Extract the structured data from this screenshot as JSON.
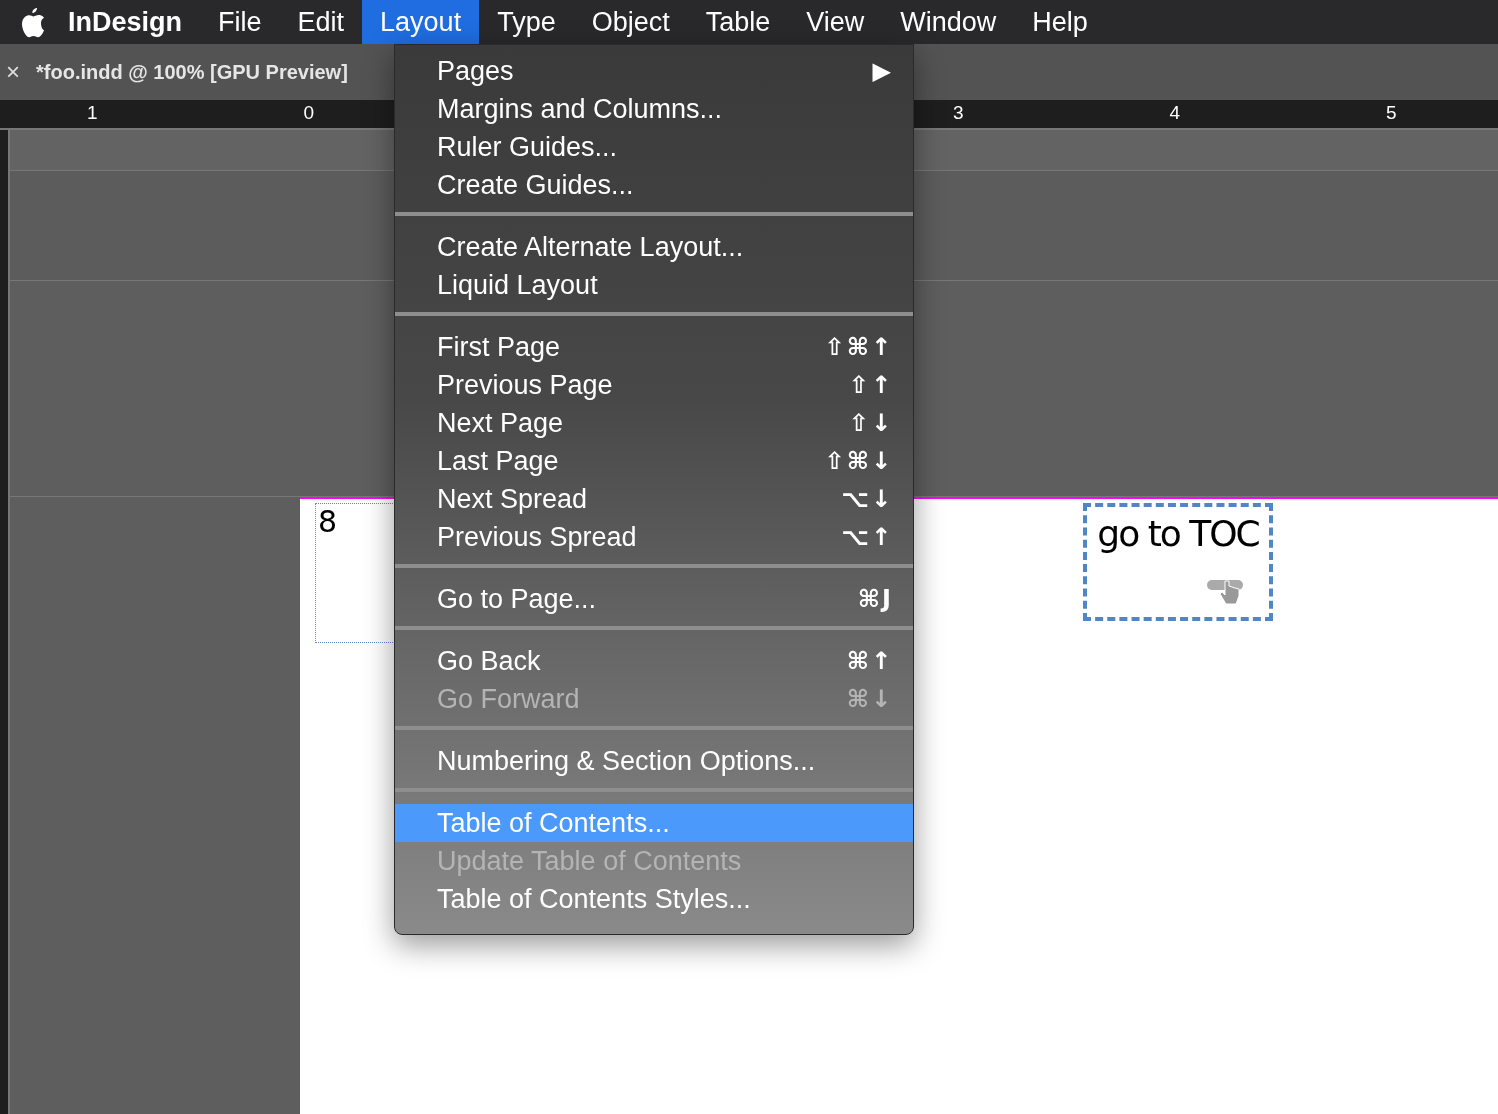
{
  "menubar": {
    "app_name": "InDesign",
    "items": [
      {
        "label": "File",
        "selected": false
      },
      {
        "label": "Edit",
        "selected": false
      },
      {
        "label": "Layout",
        "selected": true
      },
      {
        "label": "Type",
        "selected": false
      },
      {
        "label": "Object",
        "selected": false
      },
      {
        "label": "Table",
        "selected": false
      },
      {
        "label": "View",
        "selected": false
      },
      {
        "label": "Window",
        "selected": false
      },
      {
        "label": "Help",
        "selected": false
      }
    ]
  },
  "document_tab": {
    "close": "×",
    "title": "*foo.indd @ 100% [GPU Preview]"
  },
  "ruler": {
    "labels": [
      "1",
      "0",
      "3",
      "4",
      "5"
    ]
  },
  "menu": {
    "groups": [
      [
        {
          "label": "Pages",
          "shortcut": "▶",
          "disabled": false,
          "selected": false
        },
        {
          "label": "Margins and Columns...",
          "disabled": false,
          "selected": false
        },
        {
          "label": "Ruler Guides...",
          "disabled": false,
          "selected": false
        },
        {
          "label": "Create Guides...",
          "disabled": false,
          "selected": false
        }
      ],
      [
        {
          "label": "Create Alternate Layout...",
          "disabled": false,
          "selected": false
        },
        {
          "label": "Liquid Layout",
          "disabled": false,
          "selected": false
        }
      ],
      [
        {
          "label": "First Page",
          "shortcut": "⇧⌘↑",
          "disabled": false,
          "selected": false
        },
        {
          "label": "Previous Page",
          "shortcut": "⇧↑",
          "disabled": false,
          "selected": false
        },
        {
          "label": "Next Page",
          "shortcut": "⇧↓",
          "disabled": false,
          "selected": false
        },
        {
          "label": "Last Page",
          "shortcut": "⇧⌘↓",
          "disabled": false,
          "selected": false
        },
        {
          "label": "Next Spread",
          "shortcut": "⌥↓",
          "disabled": false,
          "selected": false
        },
        {
          "label": "Previous Spread",
          "shortcut": "⌥↑",
          "disabled": false,
          "selected": false
        }
      ],
      [
        {
          "label": "Go to Page...",
          "shortcut": "⌘J",
          "disabled": false,
          "selected": false
        }
      ],
      [
        {
          "label": "Go Back",
          "shortcut": "⌘↑",
          "disabled": false,
          "selected": false
        },
        {
          "label": "Go Forward",
          "shortcut": "⌘↓",
          "disabled": true,
          "selected": false
        }
      ],
      [
        {
          "label": "Numbering & Section Options...",
          "disabled": false,
          "selected": false
        }
      ],
      [
        {
          "label": "Table of Contents...",
          "disabled": false,
          "selected": true
        },
        {
          "label": "Update Table of Contents",
          "disabled": true,
          "selected": false
        },
        {
          "label": "Table of Contents Styles...",
          "disabled": false,
          "selected": false
        }
      ]
    ]
  },
  "page": {
    "page_number": "8",
    "button_label": "go to TOC"
  }
}
